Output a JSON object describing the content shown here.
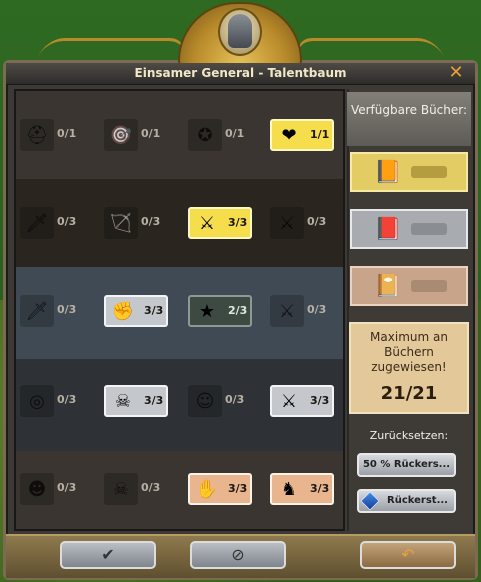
{
  "window": {
    "title": "Einsamer General  - Talentbaum",
    "close_glyph": "✕"
  },
  "tree": {
    "rows": [
      {
        "cells": [
          {
            "icon": "helmet-icon",
            "glyph": "⛑",
            "count": "0/1",
            "state": "locked"
          },
          {
            "icon": "merchant-target-icon",
            "glyph": "🎯",
            "count": "0/1",
            "state": "locked"
          },
          {
            "icon": "star-plus-icon",
            "glyph": "✪",
            "count": "0/1",
            "state": "locked"
          },
          {
            "icon": "heart-icon",
            "glyph": "❤",
            "count": "1/1",
            "state": "yellow"
          }
        ]
      },
      {
        "cells": [
          {
            "icon": "sword-shield-icon",
            "glyph": "🗡",
            "count": "0/3",
            "state": "locked"
          },
          {
            "icon": "archer-plus-icon",
            "glyph": "🏹",
            "count": "0/3",
            "state": "locked"
          },
          {
            "icon": "crossed-swords-plus-icon",
            "glyph": "⚔",
            "count": "3/3",
            "state": "yellow"
          },
          {
            "icon": "crossed-swords-clock-icon",
            "glyph": "⚔",
            "count": "0/3",
            "state": "locked"
          }
        ]
      },
      {
        "cells": [
          {
            "icon": "dagger-shield-icon",
            "glyph": "🗡",
            "count": "0/3",
            "state": "locked"
          },
          {
            "icon": "fist-icon",
            "glyph": "✊",
            "count": "3/3",
            "state": "gray"
          },
          {
            "icon": "green-star-plus-icon",
            "glyph": "★",
            "count": "2/3",
            "state": "dark"
          },
          {
            "icon": "crossed-swords-blue-icon",
            "glyph": "⚔",
            "count": "0/3",
            "state": "locked"
          }
        ]
      },
      {
        "cells": [
          {
            "icon": "target-arrow-icon",
            "glyph": "◎",
            "count": "0/3",
            "state": "locked"
          },
          {
            "icon": "skull-heart-icon",
            "glyph": "☠",
            "count": "3/3",
            "state": "gray"
          },
          {
            "icon": "soldier-plus-icon",
            "glyph": "☺",
            "count": "0/3",
            "state": "locked"
          },
          {
            "icon": "crossed-swords-shield-icon",
            "glyph": "⚔",
            "count": "3/3",
            "state": "gray"
          }
        ]
      },
      {
        "cells": [
          {
            "icon": "musketeer-icon",
            "glyph": "☻",
            "count": "0/3",
            "state": "locked"
          },
          {
            "icon": "bow-skull-icon",
            "glyph": "☠",
            "count": "0/3",
            "state": "locked"
          },
          {
            "icon": "healing-hand-icon",
            "glyph": "✋",
            "count": "3/3",
            "state": "peach"
          },
          {
            "icon": "horse-icon",
            "glyph": "♞",
            "count": "3/3",
            "state": "peach"
          }
        ]
      }
    ]
  },
  "sidebar": {
    "available_label": "Verfügbare Bücher:",
    "books": [
      {
        "icon": "gold-book-icon",
        "glyph": "📙",
        "tier": "gold"
      },
      {
        "icon": "silver-book-icon",
        "glyph": "📕",
        "tier": "silver"
      },
      {
        "icon": "bronze-book-icon",
        "glyph": "📔",
        "tier": "bronze"
      }
    ],
    "max_label": "Maximum an Büchern zugewiesen!",
    "max_count": "21/21",
    "reset_label": "Zurücksetzen:",
    "reset_half_label": "50 % Rückers...",
    "reset_full_label": "Rückerst..."
  },
  "footer": {
    "ok_glyph": "✔",
    "cancel_glyph": "⊘",
    "undo_glyph": "↶"
  }
}
